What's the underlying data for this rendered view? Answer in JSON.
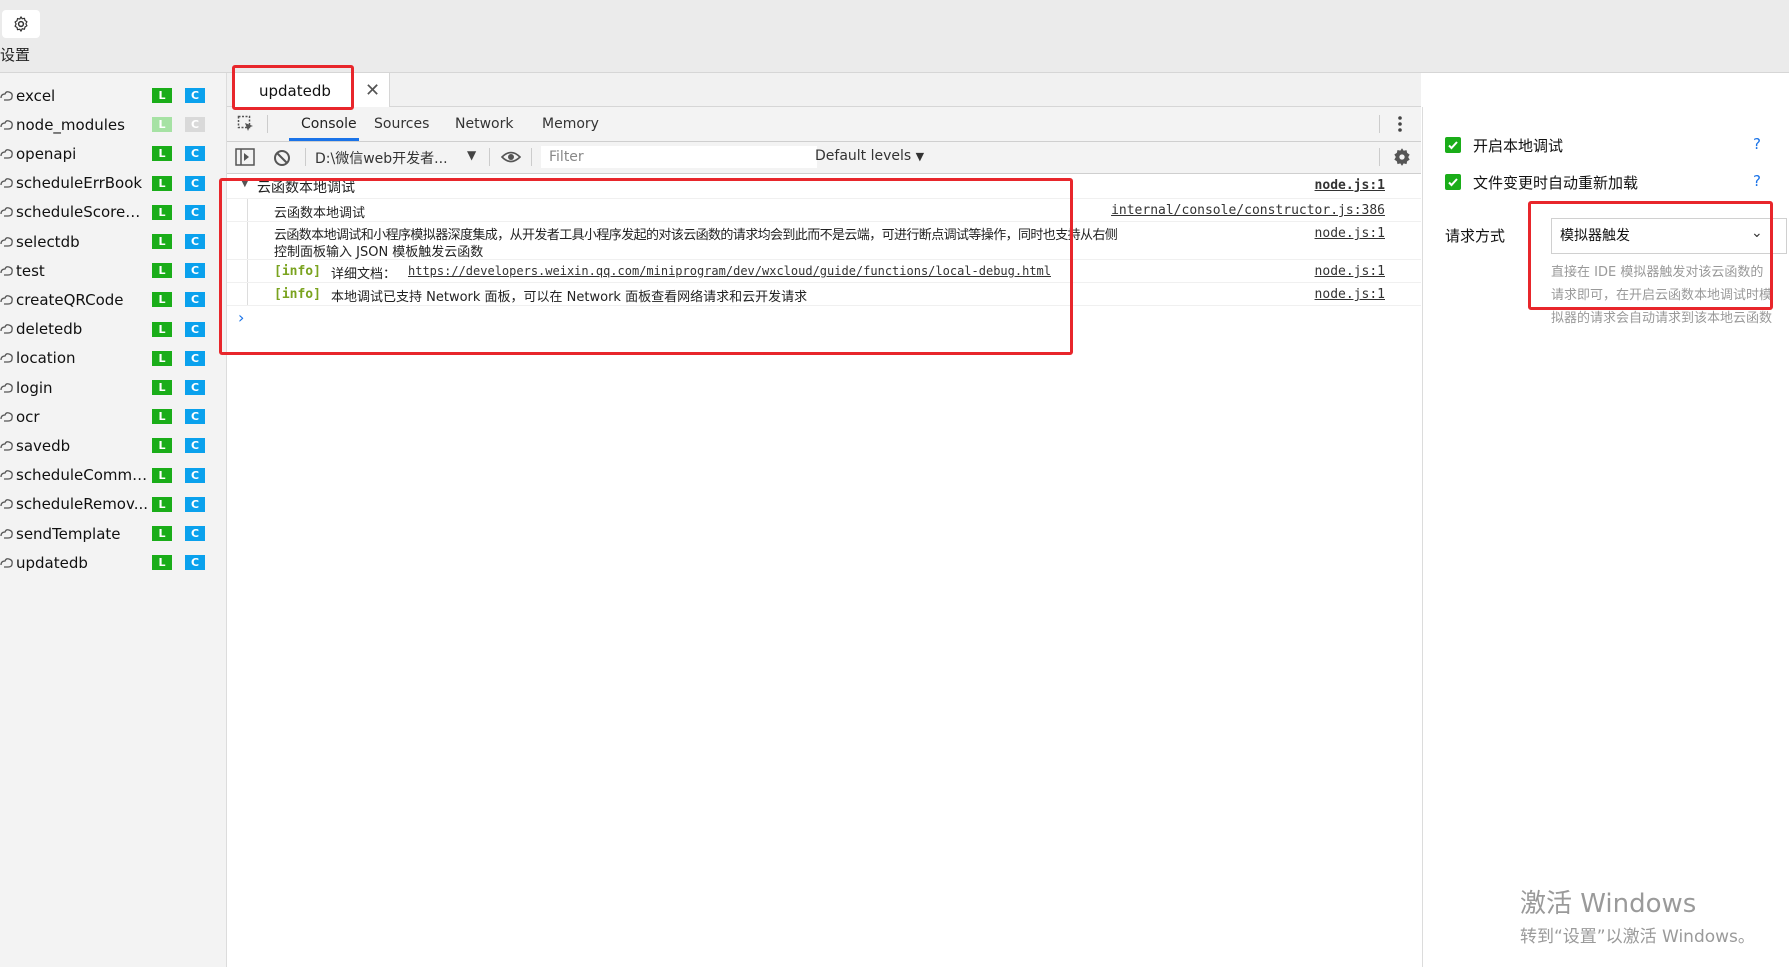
{
  "topbar": {
    "settings_label": "设置",
    "settings_icon": "gear-icon"
  },
  "sidebar": {
    "items": [
      {
        "name": "excel",
        "l": "L",
        "c": "C",
        "dim": false
      },
      {
        "name": "node_modules",
        "l": "L",
        "c": "C",
        "dim": true
      },
      {
        "name": "openapi",
        "l": "L",
        "c": "C",
        "dim": false
      },
      {
        "name": "scheduleErrBook",
        "l": "L",
        "c": "C",
        "dim": false
      },
      {
        "name": "scheduleScoreR...",
        "l": "L",
        "c": "C",
        "dim": false
      },
      {
        "name": "selectdb",
        "l": "L",
        "c": "C",
        "dim": false
      },
      {
        "name": "test",
        "l": "L",
        "c": "C",
        "dim": false
      },
      {
        "name": "createQRCode",
        "l": "L",
        "c": "C",
        "dim": false
      },
      {
        "name": "deletedb",
        "l": "L",
        "c": "C",
        "dim": false
      },
      {
        "name": "location",
        "l": "L",
        "c": "C",
        "dim": false
      },
      {
        "name": "login",
        "l": "L",
        "c": "C",
        "dim": false
      },
      {
        "name": "ocr",
        "l": "L",
        "c": "C",
        "dim": false
      },
      {
        "name": "savedb",
        "l": "L",
        "c": "C",
        "dim": false
      },
      {
        "name": "scheduleCommo...",
        "l": "L",
        "c": "C",
        "dim": false
      },
      {
        "name": "scheduleRemov...",
        "l": "L",
        "c": "C",
        "dim": false
      },
      {
        "name": "sendTemplate",
        "l": "L",
        "c": "C",
        "dim": false
      },
      {
        "name": "updatedb",
        "l": "L",
        "c": "C",
        "dim": false
      }
    ]
  },
  "file_tab": {
    "label": "updatedb",
    "close": "✕"
  },
  "devtools": {
    "tabs": [
      "Console",
      "Sources",
      "Network",
      "Memory"
    ],
    "active_tab": "Console"
  },
  "console_toolbar": {
    "context": "D:\\微信web开发者...",
    "filter_placeholder": "Filter",
    "levels": "Default levels"
  },
  "console": {
    "group_title": "云函数本地调试",
    "group_src": "node.js:1",
    "rows": [
      {
        "text": "云函数本地调试",
        "src": "internal/console/constructor.js:386"
      },
      {
        "text_line1": "云函数本地调试和小程序模拟器深度集成，从开发者工具小程序发起的对该云函数的请求均会到此而不是云端，可进行断点调试等操作，同时也支持从右侧",
        "text_line2": "控制面板输入 JSON 模板触发云函数",
        "src": "node.js:1"
      },
      {
        "tag": "[info]",
        "text": "详细文档：",
        "url": "https://developers.weixin.qq.com/miniprogram/dev/wxcloud/guide/functions/local-debug.html",
        "src": "node.js:1"
      },
      {
        "tag": "[info]",
        "text": "本地调试已支持 Network 面板，可以在 Network 面板查看网络请求和云开发请求",
        "src": "node.js:1"
      }
    ],
    "prompt": "›"
  },
  "right_panel": {
    "options": [
      {
        "label": "开启本地调试",
        "checked": true,
        "help": "?"
      },
      {
        "label": "文件变更时自动重新加载",
        "checked": true,
        "help": "?"
      }
    ],
    "request_label": "请求方式",
    "request_value": "模拟器触发",
    "request_desc": "直接在 IDE 模拟器触发对该云函数的请求即可，在开启云函数本地调试时模拟器的请求会自动请求到该本地云函数"
  },
  "watermark": {
    "line1": "激活 Windows",
    "line2": "转到“设置”以激活 Windows。"
  },
  "colors": {
    "accent_green": "#1aad19",
    "accent_blue": "#0aa1ed",
    "annotation_red": "#e8262b",
    "info_green": "#7aa31f"
  }
}
